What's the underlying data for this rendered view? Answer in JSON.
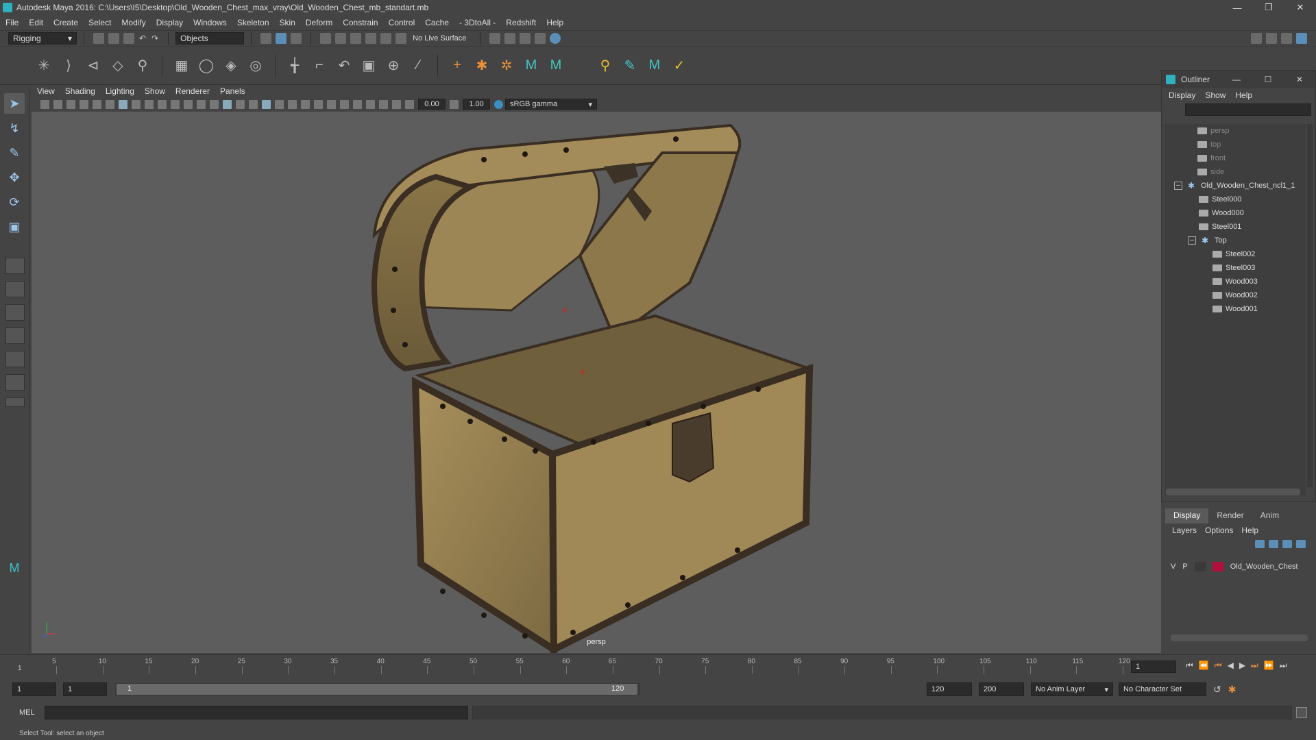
{
  "titlebar": {
    "title": "Autodesk Maya 2016: C:\\Users\\I5\\Desktop\\Old_Wooden_Chest_max_vray\\Old_Wooden_Chest_mb_standart.mb"
  },
  "menubar": [
    "File",
    "Edit",
    "Create",
    "Select",
    "Modify",
    "Display",
    "Windows",
    "Skeleton",
    "Skin",
    "Deform",
    "Constrain",
    "Control",
    "Cache",
    "- 3DtoAll -",
    "Redshift",
    "Help"
  ],
  "statusline": {
    "mode": "Rigging",
    "selection_mode": "Objects",
    "live_surface": "No Live Surface"
  },
  "panel": {
    "menus": [
      "View",
      "Shading",
      "Lighting",
      "Show",
      "Renderer",
      "Panels"
    ],
    "exposure": "0.00",
    "gamma": "1.00",
    "color_space": "sRGB gamma",
    "camera_label": "persp"
  },
  "outliner": {
    "title": "Outliner",
    "menus": [
      "Display",
      "Show",
      "Help"
    ],
    "items": [
      {
        "label": "persp",
        "type": "camera",
        "dim": true
      },
      {
        "label": "top",
        "type": "camera",
        "dim": true
      },
      {
        "label": "front",
        "type": "camera",
        "dim": true
      },
      {
        "label": "side",
        "type": "camera",
        "dim": true
      },
      {
        "label": "Old_Wooden_Chest_ncl1_1",
        "type": "group"
      },
      {
        "label": "Steel000",
        "type": "mesh"
      },
      {
        "label": "Wood000",
        "type": "mesh"
      },
      {
        "label": "Steel001",
        "type": "mesh"
      },
      {
        "label": "Top",
        "type": "group"
      },
      {
        "label": "Steel002",
        "type": "mesh"
      },
      {
        "label": "Steel003",
        "type": "mesh"
      },
      {
        "label": "Wood003",
        "type": "mesh"
      },
      {
        "label": "Wood002",
        "type": "mesh"
      },
      {
        "label": "Wood001",
        "type": "mesh"
      }
    ]
  },
  "layer_editor": {
    "tabs": [
      "Display",
      "Render",
      "Anim"
    ],
    "menus": [
      "Layers",
      "Options",
      "Help"
    ],
    "layer": {
      "v": "V",
      "p": "P",
      "name": "Old_Wooden_Chest",
      "color": "#b0103a"
    }
  },
  "timeline": {
    "ticks": [
      "5",
      "10",
      "15",
      "20",
      "25",
      "30",
      "35",
      "40",
      "45",
      "50",
      "55",
      "60",
      "65",
      "70",
      "75",
      "80",
      "85",
      "90",
      "95",
      "100",
      "105",
      "110",
      "115",
      "120"
    ],
    "start_marker": "1",
    "current_frame": "1"
  },
  "range": {
    "start": "1",
    "playback_start": "1",
    "slider_start": "1",
    "slider_end": "120",
    "playback_end": "120",
    "end": "200",
    "anim_layer": "No Anim Layer",
    "character_set": "No Character Set"
  },
  "mel": {
    "label": "MEL"
  },
  "helpline": {
    "text": "Select Tool: select an object"
  }
}
